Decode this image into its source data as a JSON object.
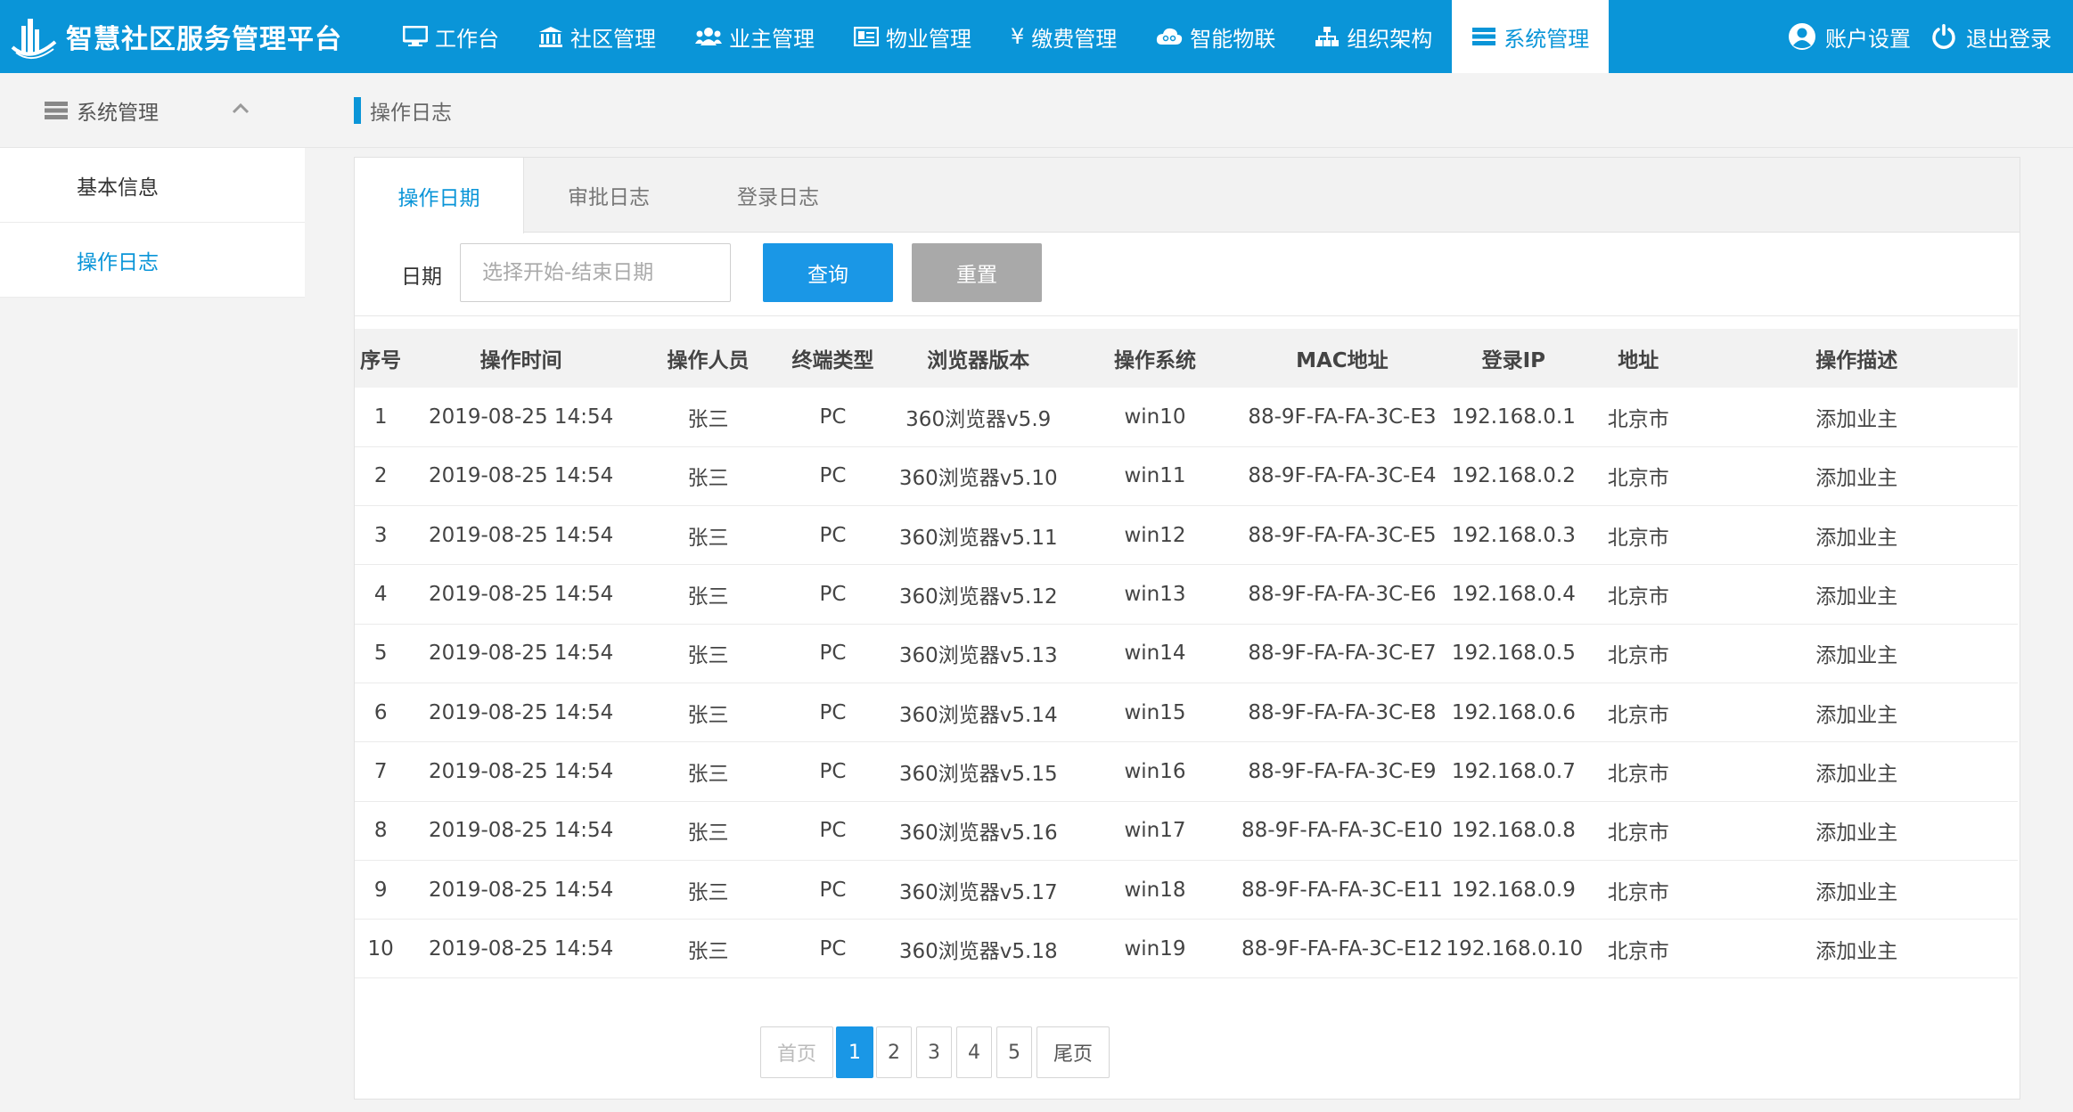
{
  "brand": {
    "title": "智慧社区服务管理平台"
  },
  "nav": [
    {
      "label": "工作台",
      "icon": "monitor-icon"
    },
    {
      "label": "社区管理",
      "icon": "building-icon"
    },
    {
      "label": "业主管理",
      "icon": "users-icon"
    },
    {
      "label": "物业管理",
      "icon": "id-card-icon"
    },
    {
      "label": "缴费管理",
      "icon": "yen-icon"
    },
    {
      "label": "智能物联",
      "icon": "cloud-icon"
    },
    {
      "label": "组织架构",
      "icon": "sitemap-icon"
    },
    {
      "label": "系统管理",
      "icon": "server-icon",
      "active": true
    }
  ],
  "header_right": {
    "account": "账户设置",
    "logout": "退出登录"
  },
  "sidebar": {
    "title": "系统管理",
    "items": [
      {
        "label": "基本信息"
      },
      {
        "label": "操作日志",
        "active": true
      }
    ]
  },
  "breadcrumb": "操作日志",
  "tabs": [
    {
      "label": "操作日期",
      "active": true
    },
    {
      "label": "审批日志"
    },
    {
      "label": "登录日志"
    }
  ],
  "filter": {
    "label": "日期",
    "placeholder": "选择开始-结束日期",
    "query": "查询",
    "reset": "重置"
  },
  "table": {
    "columns": [
      "序号",
      "操作时间",
      "操作人员",
      "终端类型",
      "浏览器版本",
      "操作系统",
      "MAC地址",
      "登录IP",
      "地址",
      "操作描述"
    ],
    "rows": [
      [
        "1",
        "2019-08-25 14:54",
        "张三",
        "PC",
        "360浏览器v5.9",
        "win10",
        "88-9F-FA-FA-3C-E3",
        "192.168.0.1",
        "北京市",
        "添加业主"
      ],
      [
        "2",
        "2019-08-25 14:54",
        "张三",
        "PC",
        "360浏览器v5.10",
        "win11",
        "88-9F-FA-FA-3C-E4",
        "192.168.0.2",
        "北京市",
        "添加业主"
      ],
      [
        "3",
        "2019-08-25 14:54",
        "张三",
        "PC",
        "360浏览器v5.11",
        "win12",
        "88-9F-FA-FA-3C-E5",
        "192.168.0.3",
        "北京市",
        "添加业主"
      ],
      [
        "4",
        "2019-08-25 14:54",
        "张三",
        "PC",
        "360浏览器v5.12",
        "win13",
        "88-9F-FA-FA-3C-E6",
        "192.168.0.4",
        "北京市",
        "添加业主"
      ],
      [
        "5",
        "2019-08-25 14:54",
        "张三",
        "PC",
        "360浏览器v5.13",
        "win14",
        "88-9F-FA-FA-3C-E7",
        "192.168.0.5",
        "北京市",
        "添加业主"
      ],
      [
        "6",
        "2019-08-25 14:54",
        "张三",
        "PC",
        "360浏览器v5.14",
        "win15",
        "88-9F-FA-FA-3C-E8",
        "192.168.0.6",
        "北京市",
        "添加业主"
      ],
      [
        "7",
        "2019-08-25 14:54",
        "张三",
        "PC",
        "360浏览器v5.15",
        "win16",
        "88-9F-FA-FA-3C-E9",
        "192.168.0.7",
        "北京市",
        "添加业主"
      ],
      [
        "8",
        "2019-08-25 14:54",
        "张三",
        "PC",
        "360浏览器v5.16",
        "win17",
        "88-9F-FA-FA-3C-E10",
        "192.168.0.8",
        "北京市",
        "添加业主"
      ],
      [
        "9",
        "2019-08-25 14:54",
        "张三",
        "PC",
        "360浏览器v5.17",
        "win18",
        "88-9F-FA-FA-3C-E11",
        "192.168.0.9",
        "北京市",
        "添加业主"
      ],
      [
        "10",
        "2019-08-25 14:54",
        "张三",
        "PC",
        "360浏览器v5.18",
        "win19",
        "88-9F-FA-FA-3C-E12",
        "192.168.0.10",
        "北京市",
        "添加业主"
      ]
    ]
  },
  "pagination": {
    "first": "首页",
    "pages": [
      "1",
      "2",
      "3",
      "4",
      "5"
    ],
    "current": "1",
    "last": "尾页"
  },
  "colors": {
    "primary": "#0a95d8",
    "button": "#1a97e6",
    "reset": "#a9a9a9"
  }
}
